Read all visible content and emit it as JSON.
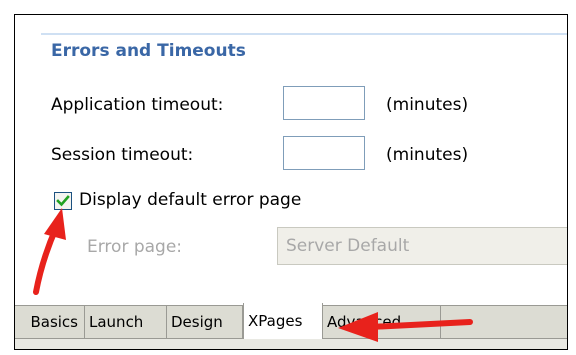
{
  "section": {
    "title": "Errors and Timeouts"
  },
  "app_timeout": {
    "label": "Application timeout:",
    "value": "",
    "unit": "(minutes)"
  },
  "session_timeout": {
    "label": "Session timeout:",
    "value": "",
    "unit": "(minutes)"
  },
  "default_error": {
    "label": "Display default error page",
    "checked": true
  },
  "error_page": {
    "label": "Error page:",
    "value": "Server Default"
  },
  "tabs": [
    {
      "label": "Basics"
    },
    {
      "label": "Launch"
    },
    {
      "label": "Design"
    },
    {
      "label": "XPages",
      "active": true
    },
    {
      "label": "Advanced"
    }
  ],
  "colors": {
    "section_title": "#3a67a6",
    "annotation_arrow": "#e8221c",
    "checkmark": "#21a121",
    "disabled_text": "#a8a8a8"
  }
}
